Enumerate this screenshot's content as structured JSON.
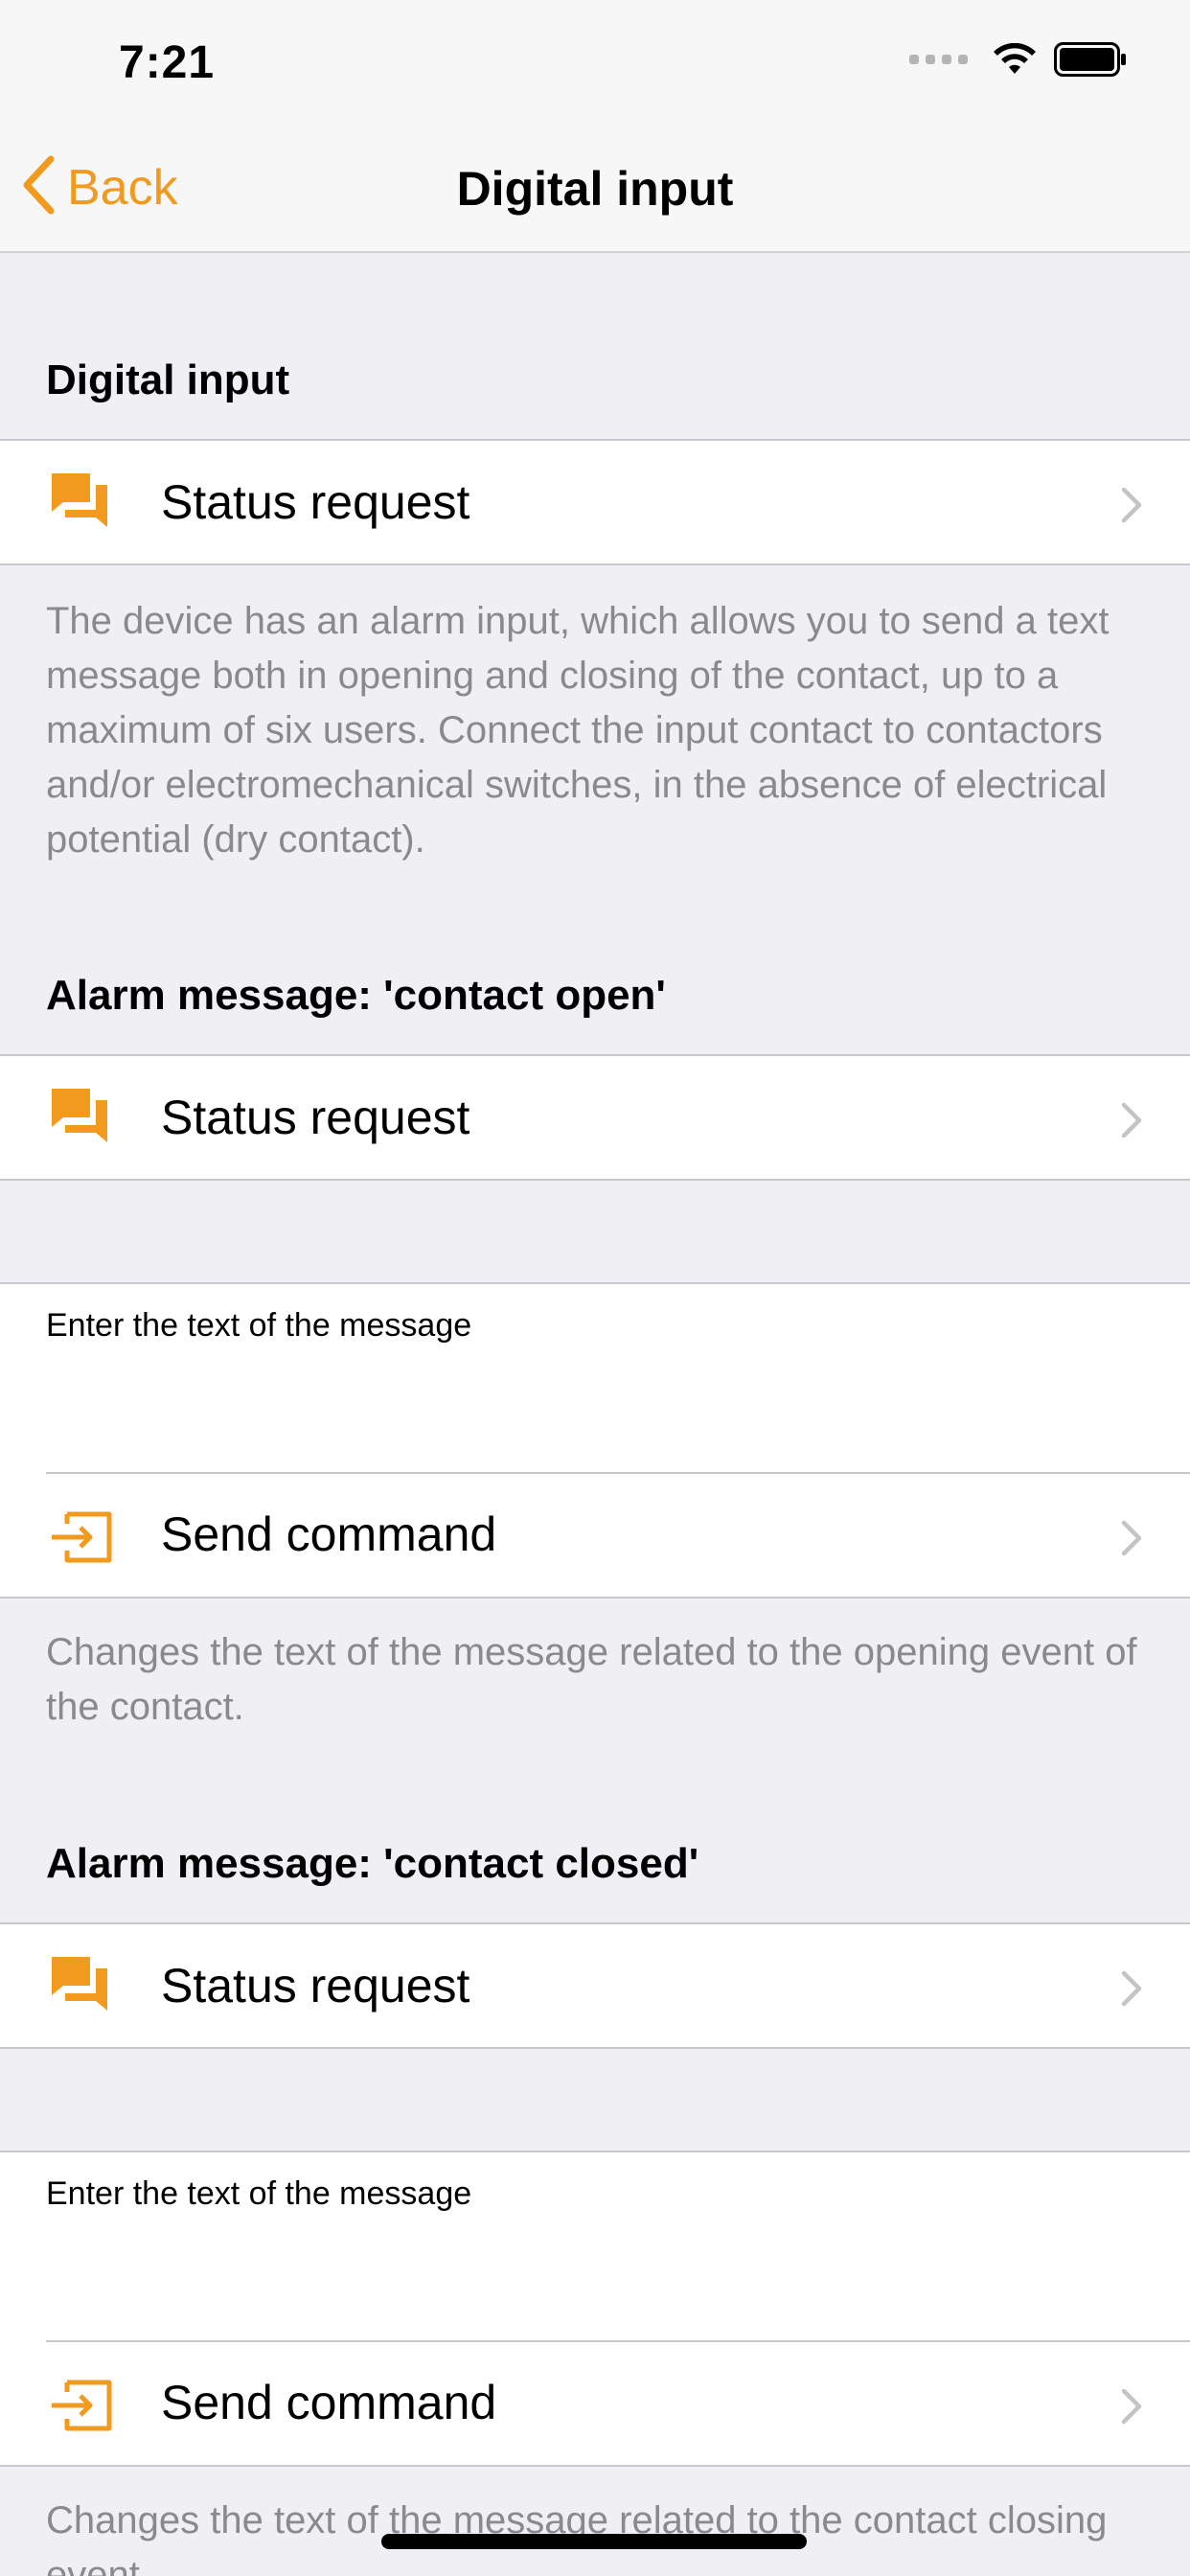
{
  "status_bar": {
    "time": "7:21"
  },
  "nav": {
    "back_label": "Back",
    "title": "Digital input"
  },
  "section1": {
    "header": "Digital input",
    "row_label": "Status request",
    "footer": "The device has an alarm input, which allows you to send a text message both in opening and closing of the contact, up to a maximum of six users. Connect the input contact to contactors and/or electromechanical switches, in the absence of electrical potential (dry contact)."
  },
  "section2": {
    "header": "Alarm message: 'contact open'",
    "row_label": "Status request",
    "text_caption": "Enter the text of the message",
    "text_value": "",
    "send_label": "Send command",
    "footer": "Changes the text of the message related to the opening event of the contact."
  },
  "section3": {
    "header": "Alarm message: 'contact closed'",
    "row_label": "Status request",
    "text_caption": "Enter the text of the message",
    "text_value": "",
    "send_label": "Send command",
    "footer": "Changes the text of the message related to the contact closing event."
  },
  "icons": {
    "status_request": "chat-bubbles-icon",
    "send_command": "input-arrow-icon",
    "disclosure": "chevron-right-icon",
    "back": "chevron-left-icon"
  },
  "colors": {
    "accent": "#F29A1E",
    "background": "#EFEFF4",
    "secondary_text": "#8A8A8E"
  }
}
